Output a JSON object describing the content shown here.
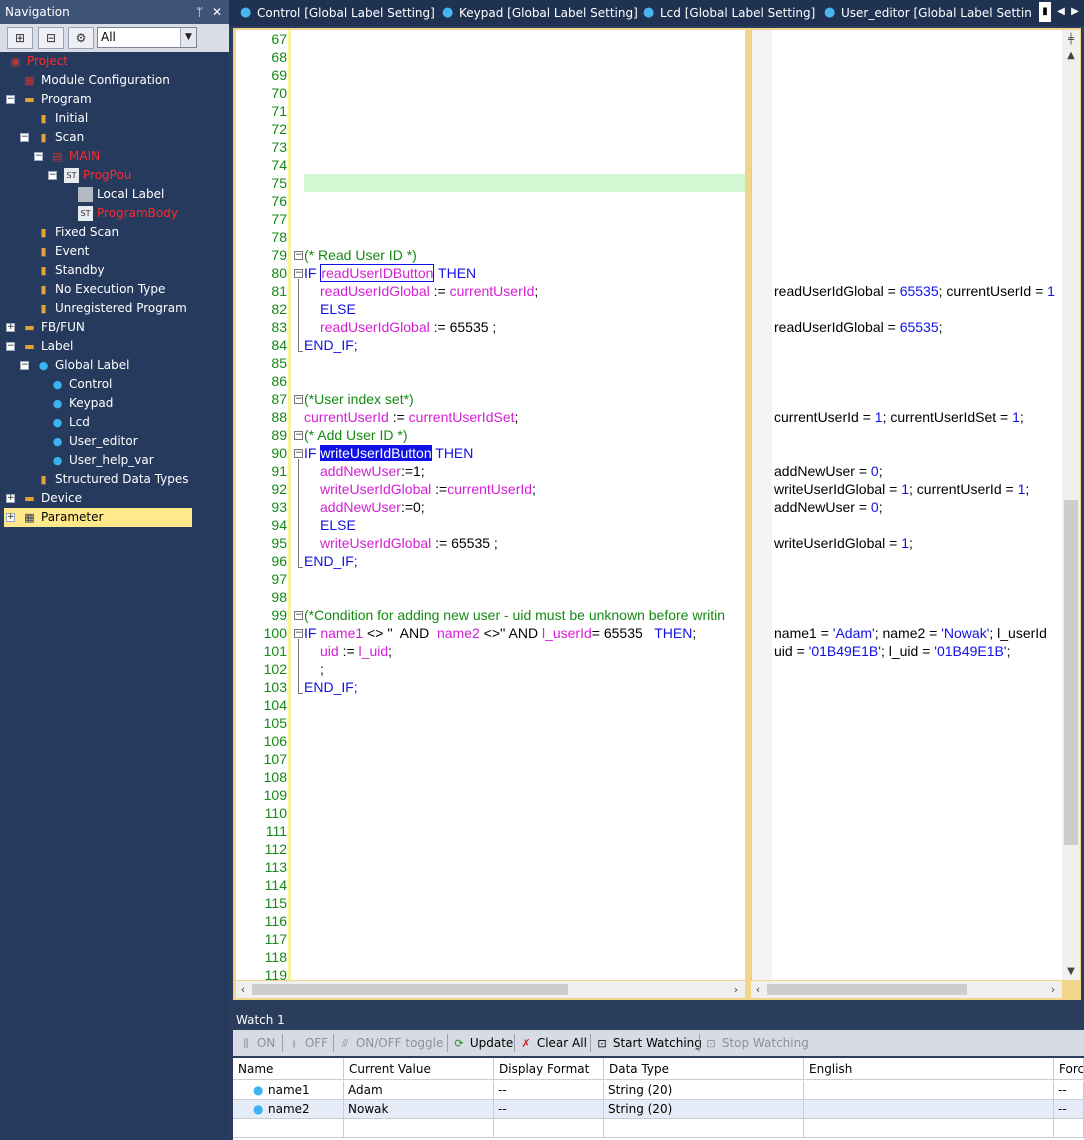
{
  "navigation": {
    "title": "Navigation",
    "pin": "ᛘ",
    "close": "✕",
    "filter_value": "All",
    "tree": [
      {
        "label": "Project",
        "red": true
      },
      {
        "label": "Module Configuration"
      },
      {
        "label": "Program"
      },
      {
        "label": "Initial"
      },
      {
        "label": "Scan"
      },
      {
        "label": "MAIN",
        "red": true
      },
      {
        "label": "ProgPou",
        "red": true
      },
      {
        "label": "Local Label"
      },
      {
        "label": "ProgramBody",
        "red": true
      },
      {
        "label": "Fixed Scan"
      },
      {
        "label": "Event"
      },
      {
        "label": "Standby"
      },
      {
        "label": "No Execution Type"
      },
      {
        "label": "Unregistered Program"
      },
      {
        "label": "FB/FUN"
      },
      {
        "label": "Label"
      },
      {
        "label": "Global Label"
      },
      {
        "label": "Control"
      },
      {
        "label": "Keypad"
      },
      {
        "label": "Lcd"
      },
      {
        "label": "User_editor"
      },
      {
        "label": "User_help_var"
      },
      {
        "label": "Structured Data Types"
      },
      {
        "label": "Device"
      },
      {
        "label": "Parameter",
        "selected": true
      }
    ]
  },
  "tabs": [
    {
      "label": "Control [Global Label Setting]"
    },
    {
      "label": "Keypad [Global Label Setting]"
    },
    {
      "label": "Lcd [Global Label Setting]"
    },
    {
      "label": "User_editor [Global Label Settin..."
    }
  ],
  "editor": {
    "line_numbers": [
      "67",
      "68",
      "69",
      "70",
      "71",
      "72",
      "73",
      "74",
      "75",
      "76",
      "77",
      "78",
      "79",
      "80",
      "81",
      "82",
      "83",
      "84",
      "85",
      "86",
      "87",
      "88",
      "89",
      "90",
      "91",
      "92",
      "93",
      "94",
      "95",
      "96",
      "97",
      "98",
      "99",
      "100",
      "101",
      "102",
      "103",
      "104",
      "105",
      "106",
      "107",
      "108",
      "109",
      "110",
      "111",
      "112",
      "113",
      "114",
      "115",
      "116",
      "117",
      "118",
      "119"
    ],
    "code": {
      "l79_cmt": "(* Read User ID *)",
      "l80_if": "IF ",
      "l80_var": "readUserIDButton",
      "l80_then": " THEN",
      "l81_var1": "readUserIdGlobal",
      "l81_op": " := ",
      "l81_var2": "currentUserId",
      "l81_end": ";",
      "l82_else": "ELSE",
      "l83_var": "readUserIdGlobal",
      "l83_rest": " := 65535 ;",
      "l84_endif": "END_IF;",
      "l87_cmt": "(*User index set*)",
      "l88_var1": "currentUserId",
      "l88_op": " := ",
      "l88_var2": "currentUserIdSet",
      "l88_end": ";",
      "l89_cmt": "(* Add User ID *)",
      "l90_if": "IF ",
      "l90_var": "writeUserIdButton",
      "l90_then": " THEN",
      "l91_var": "addNewUser",
      "l91_rest": ":=1;",
      "l92_var1": "writeUserIdGlobal",
      "l92_op": " :=",
      "l92_var2": "currentUserId",
      "l92_end": ";",
      "l93_var": "addNewUser",
      "l93_rest": ":=0;",
      "l94_else": "ELSE",
      "l95_var": "writeUserIdGlobal",
      "l95_rest": " := 65535 ;",
      "l96_endif": "END_IF;",
      "l99_cmt": "(*Condition for adding new user - uid must be unknown before writin",
      "l100_if": "IF ",
      "l100_var1": "name1",
      "l100_op1": " <> ''  AND  ",
      "l100_var2": "name2",
      "l100_op2": " <>'' AND ",
      "l100_var3": "l_userId",
      "l100_op3": "= 65535   ",
      "l100_then": "THEN",
      "l100_end": ";",
      "l101_var1": "uid",
      "l101_op": " := ",
      "l101_var2": "l_uid",
      "l101_end": ";",
      "l102_semi": ";",
      "l103_endif": "END_IF;"
    },
    "monitor": {
      "m81a": "readUserIdGlobal = ",
      "m81b": "65535",
      "m81c": "; currentUserId = ",
      "m81d": "1",
      "m83a": "readUserIdGlobal = ",
      "m83b": "65535",
      "m83c": ";",
      "m88a": "currentUserId = ",
      "m88b": "1",
      "m88c": "; currentUserIdSet = ",
      "m88d": "1",
      "m88e": ";",
      "m91a": "addNewUser = ",
      "m91b": "0",
      "m91c": ";",
      "m92a": "writeUserIdGlobal = ",
      "m92b": "1",
      "m92c": "; currentUserId = ",
      "m92d": "1",
      "m92e": ";",
      "m93a": "addNewUser = ",
      "m93b": "0",
      "m93c": ";",
      "m95a": "writeUserIdGlobal = ",
      "m95b": "1",
      "m95c": ";",
      "m100a": "name1 = ",
      "m100b": "'Adam'",
      "m100c": "; name2 = ",
      "m100d": "'Nowak'",
      "m100e": "; l_userId",
      "m101a": "uid = ",
      "m101b": "'01B49E1B'",
      "m101c": "; l_uid = ",
      "m101d": "'01B49E1B'",
      "m101e": ";"
    }
  },
  "watch": {
    "title": "Watch 1",
    "toolbar": {
      "on": "ON",
      "off": "OFF",
      "toggle": "ON/OFF toggle",
      "update": "Update",
      "clear_all": "Clear All",
      "start": "Start Watching",
      "stop": "Stop Watching"
    },
    "columns": [
      "Name",
      "Current Value",
      "Display Format",
      "Data Type",
      "English",
      "Force"
    ],
    "rows": [
      {
        "name": "name1",
        "value": "Adam",
        "format": "--",
        "type": "String (20)",
        "english": "",
        "force": "--"
      },
      {
        "name": "name2",
        "value": "Nowak",
        "format": "--",
        "type": "String (20)",
        "english": "",
        "force": "--"
      }
    ]
  },
  "colors": {
    "keyword": "#1010e6",
    "variable": "#d41fd4",
    "comment": "#138a13",
    "line_number": "#138a13",
    "current_line": "#d3f7d3",
    "selection": "#1010e6",
    "tree_selected": "#ffe98a",
    "program_red": "#ff2a2a"
  }
}
